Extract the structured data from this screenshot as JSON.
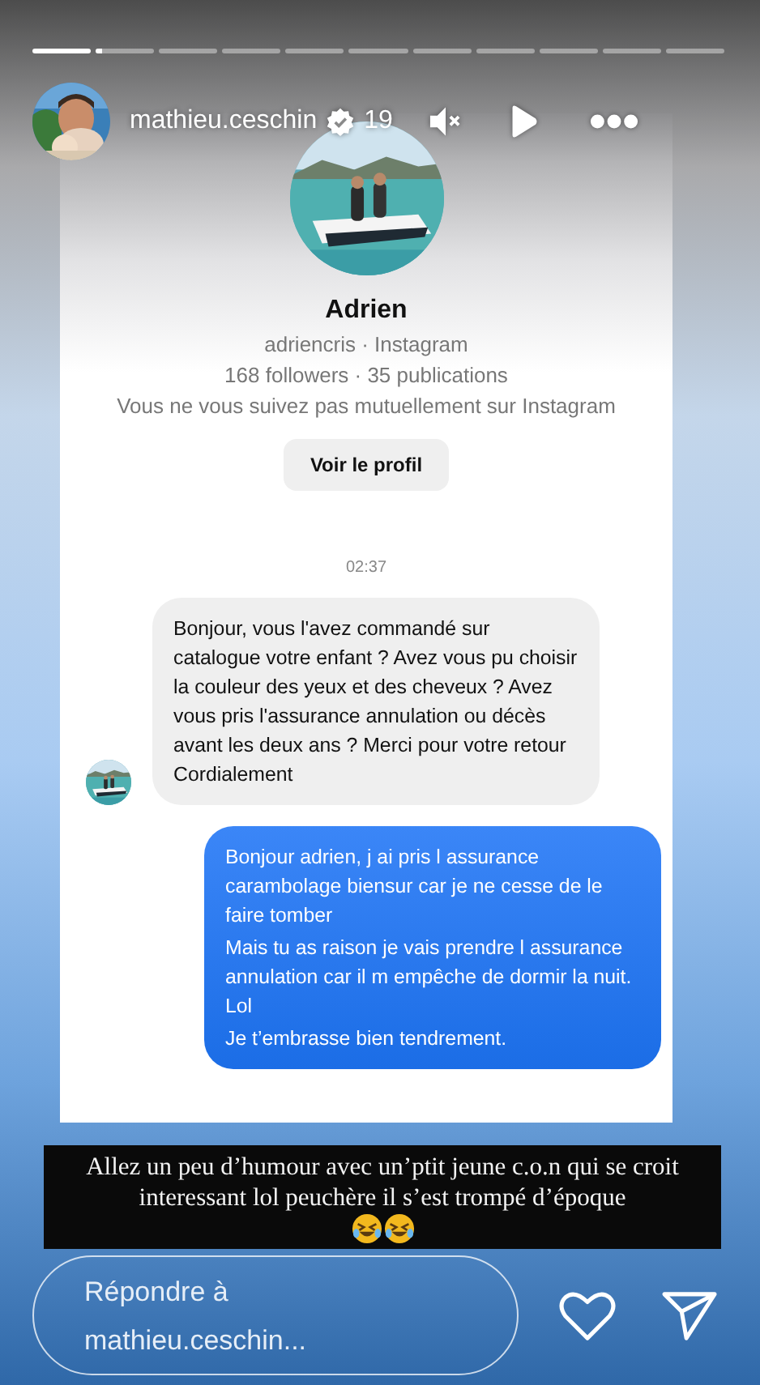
{
  "progress": [
    {
      "level": 1
    },
    {
      "level": 0.1
    },
    {
      "level": 0
    },
    {
      "level": 0
    },
    {
      "level": 0
    },
    {
      "level": 0
    },
    {
      "level": 0
    },
    {
      "level": 0
    },
    {
      "level": 0
    },
    {
      "level": 0
    },
    {
      "level": 0
    }
  ],
  "header": {
    "username": "mathieu.ceschin",
    "verified": true,
    "time": "19"
  },
  "dm": {
    "name": "Adrien",
    "handle_line": "adriencris · Instagram",
    "stats": "168 followers · 35 publications",
    "mutual_note": "Vous ne vous suivez pas mutuellement sur Instagram",
    "profile_button": "Voir le profil",
    "timestamp": "02:37",
    "messages": [
      {
        "kind": "received",
        "paragraphs": [
          "Bonjour, vous l'avez commandé sur catalogue votre enfant ? Avez vous pu choisir la couleur des yeux et des cheveux ? Avez vous pris l'assurance annulation ou décès avant les deux ans ? Merci pour votre retour",
          "Cordialement"
        ]
      },
      {
        "kind": "sent",
        "paragraphs": [
          "Bonjour adrien, j ai pris l assurance carambolage biensur car je ne cesse de le faire tomber",
          "Mais tu as raison je vais prendre l assurance annulation car il m empêche de dormir la nuit. Lol",
          "Je t’embrasse bien tendrement."
        ]
      }
    ]
  },
  "caption": "Allez un peu d’humour avec un’ptit jeune c.o.n qui se croit interessant lol peuchère il s’est trompé d’époque",
  "reply": {
    "placeholder": "Répondre à mathieu.ceschin..."
  }
}
